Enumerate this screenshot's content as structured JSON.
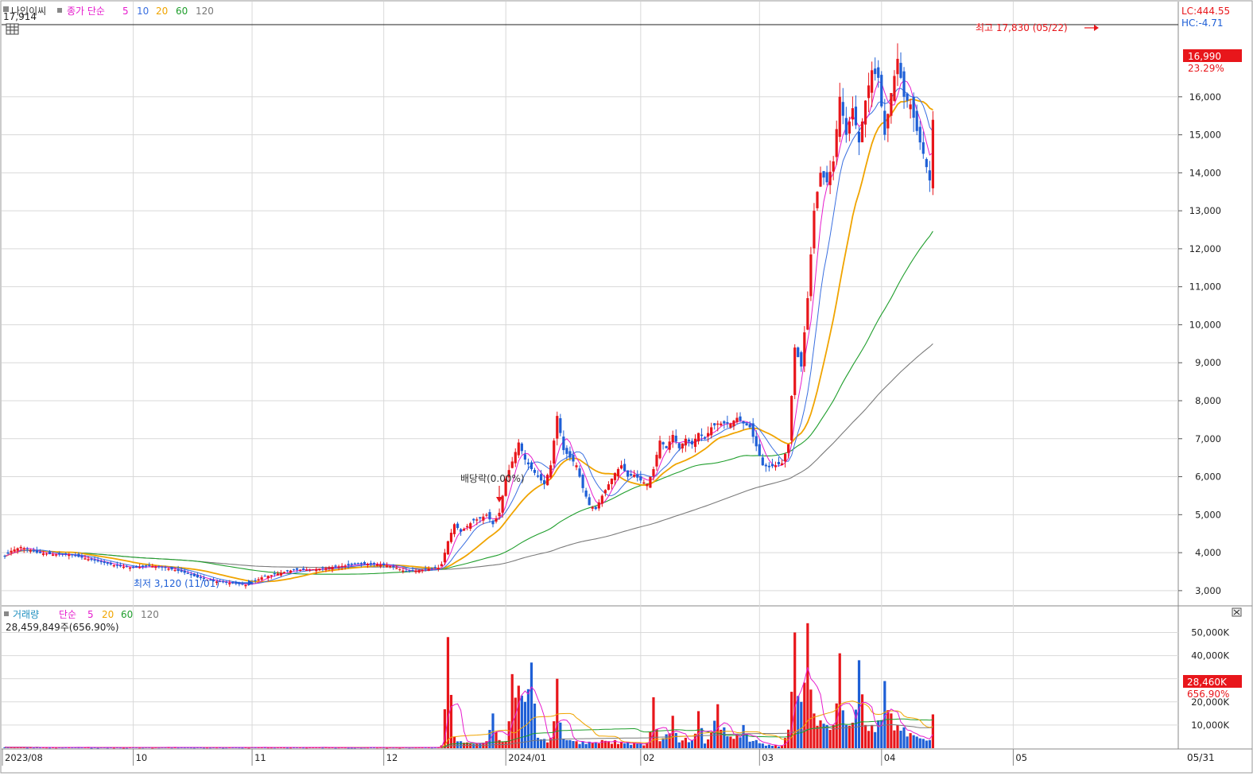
{
  "header": {
    "stock_name": "나인이씨",
    "legend_title": "종가 단순",
    "ma_periods": [
      "5",
      "10",
      "20",
      "60",
      "120"
    ],
    "top_value": "17,914",
    "lc": "LC:444.55",
    "hc": "HC:-4.71",
    "high_annotation": "최고 17,830 (05/22)",
    "low_annotation": "최저 3,120 (11/01)",
    "dividend_annotation": "배당락(0.00%)",
    "last_price_badge": "16,990",
    "last_change": "23.29%"
  },
  "volume_header": {
    "title": "거래량",
    "legend_title": "단순",
    "ma_periods": [
      "5",
      "20",
      "60",
      "120"
    ],
    "current_volume": "28,459,849주(656.90%)",
    "last_volume_badge": "28,460K",
    "last_volume_pct": "656.90%"
  },
  "x_axis": {
    "labels": [
      {
        "text": "2023/08",
        "index": 0
      },
      {
        "text": "10",
        "index": 41
      },
      {
        "text": "11",
        "index": 78
      },
      {
        "text": "12",
        "index": 119
      },
      {
        "text": "2024/01",
        "index": 157
      },
      {
        "text": "02",
        "index": 199
      },
      {
        "text": "03",
        "index": 236
      },
      {
        "text": "04",
        "index": 274
      },
      {
        "text": "05",
        "index": 315
      }
    ],
    "end_label": "05/31"
  },
  "colors": {
    "up": "#e8161b",
    "down": "#1e5fd6",
    "ma5": "#e61ccd",
    "ma10": "#3a6fe0",
    "ma20": "#f0a400",
    "ma60": "#1f9e2c",
    "ma120": "#7a7a7a",
    "grid": "#d9d9d9",
    "badge": "#e8161b"
  },
  "chart_data": {
    "type": "candlestick",
    "price_axis": {
      "ticks": [
        "3,000",
        "4,000",
        "5,000",
        "6,000",
        "7,000",
        "8,000",
        "9,000",
        "10,000",
        "11,000",
        "12,000",
        "13,000",
        "14,000",
        "15,000",
        "16,000"
      ],
      "ylim": [
        2600,
        17900
      ]
    },
    "volume_axis": {
      "ticks": [
        "10,000K",
        "20,000K",
        "30,000K",
        "40,000K",
        "50,000K"
      ],
      "ylim": [
        0,
        56000
      ]
    },
    "anchors": {
      "index": [
        0,
        2,
        5,
        10,
        15,
        20,
        25,
        30,
        35,
        40,
        45,
        50,
        55,
        60,
        65,
        70,
        75,
        77,
        80,
        85,
        90,
        95,
        100,
        105,
        110,
        115,
        120,
        125,
        130,
        135,
        136,
        138,
        140,
        142,
        144,
        146,
        148,
        150,
        152,
        154,
        156,
        158,
        160,
        162,
        164,
        166,
        168,
        170,
        172,
        174,
        176,
        178,
        180,
        182,
        184,
        186,
        188,
        190,
        192,
        194,
        196,
        198,
        200,
        202,
        204,
        206,
        208,
        210,
        212,
        214,
        216,
        218,
        220,
        222,
        224,
        226,
        228,
        230,
        232,
        234,
        236,
        238,
        240,
        242,
        244,
        246,
        248,
        250,
        252,
        254,
        256,
        258,
        260,
        262,
        264,
        266,
        268,
        270,
        272,
        274,
        276,
        278,
        280,
        282,
        284,
        286,
        288,
        290,
        292,
        294,
        296,
        298,
        300,
        302,
        304,
        306,
        308,
        310,
        312,
        314,
        316,
        318,
        320,
        322,
        324,
        326,
        328,
        330,
        332,
        334,
        336,
        338,
        340,
        342,
        344,
        346,
        348,
        350,
        352,
        354,
        355
      ],
      "close": [
        3900,
        4050,
        4150,
        4000,
        3950,
        3950,
        3850,
        3750,
        3650,
        3600,
        3650,
        3600,
        3500,
        3350,
        3250,
        3200,
        3150,
        3200,
        3350,
        3450,
        3550,
        3550,
        3600,
        3650,
        3700,
        3700,
        3650,
        3500,
        3550,
        3600,
        3700,
        4300,
        4750,
        4550,
        4700,
        4850,
        4900,
        5000,
        4750,
        5050,
        5950,
        6400,
        6900,
        6450,
        6200,
        6000,
        5800,
        6300,
        7600,
        6700,
        6500,
        6300,
        5700,
        5250,
        5150,
        5500,
        5800,
        6100,
        6300,
        6000,
        6050,
        5900,
        5800,
        6200,
        6950,
        6750,
        7100,
        6750,
        7000,
        6850,
        7150,
        7000,
        7300,
        7400,
        7400,
        7400,
        7550,
        7400,
        7300,
        6800,
        6300,
        6250,
        6300,
        6350,
        6850,
        9400,
        8900,
        10700,
        13000,
        14000,
        13750,
        14300,
        16000,
        15000,
        15700,
        14800,
        15900,
        16700,
        16500,
        15000,
        16100,
        17000,
        16000,
        15800,
        15100,
        14500,
        13800,
        16990
      ],
      "volume": [
        400,
        400,
        400,
        400,
        400,
        400,
        400,
        400,
        400,
        400,
        400,
        400,
        400,
        400,
        400,
        400,
        400,
        400,
        400,
        400,
        400,
        400,
        400,
        400,
        400,
        400,
        400,
        400,
        400,
        400,
        1200,
        48000,
        5000,
        3000,
        2500,
        1800,
        2000,
        3000,
        15000,
        3500,
        3000,
        32000,
        27000,
        20000,
        37000,
        4500,
        4000,
        4500,
        30000,
        4000,
        3500,
        3000,
        3000,
        2800,
        2500,
        3500,
        3000,
        3500,
        2800,
        2500,
        2500,
        2000,
        2300,
        22000,
        3000,
        6000,
        14000,
        2500,
        4500,
        3500,
        16000,
        2000,
        7000,
        19000,
        9000,
        5000,
        6000,
        10000,
        2800,
        3500,
        2000,
        1500,
        1200,
        1000,
        8000,
        50000,
        20000,
        54000,
        15000,
        12000,
        10000,
        10000,
        41000,
        10000,
        11000,
        38000,
        10000,
        10000,
        12000,
        29000,
        15000,
        10000,
        9000,
        6500,
        5000,
        4000,
        3500,
        28460
      ]
    },
    "count": 356,
    "series": [
      {
        "name": "종가 단순 5",
        "color_key": "ma5"
      },
      {
        "name": "10",
        "color_key": "ma10"
      },
      {
        "name": "20",
        "color_key": "ma20"
      },
      {
        "name": "60",
        "color_key": "ma60"
      },
      {
        "name": "120",
        "color_key": "ma120"
      }
    ]
  }
}
